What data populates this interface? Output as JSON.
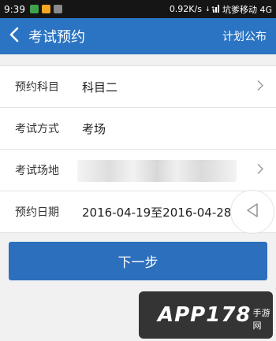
{
  "status_bar": {
    "time": "9:39",
    "speed": "0.92K/s",
    "carrier": "坑爹移动 4G",
    "app_icon_colors": [
      "#3fa34d",
      "#f5a623",
      "#8a8a8a"
    ]
  },
  "app_bar": {
    "title": "考试预约",
    "right_action": "计划公布",
    "color": "#2b74c3"
  },
  "form": {
    "rows": [
      {
        "label": "预约科目",
        "value": "科目二",
        "has_arrow": true
      },
      {
        "label": "考试方式",
        "value": "考场",
        "has_arrow": false
      },
      {
        "label": "考试场地",
        "value": "",
        "has_arrow": true,
        "blurred": true
      },
      {
        "label": "预约日期",
        "value": "2016-04-19至2016-04-28",
        "has_arrow": false
      }
    ]
  },
  "next_button": {
    "label": "下一步",
    "color": "#2c6fbd"
  },
  "watermark": {
    "text": "APP178",
    "sub": "手游网"
  }
}
